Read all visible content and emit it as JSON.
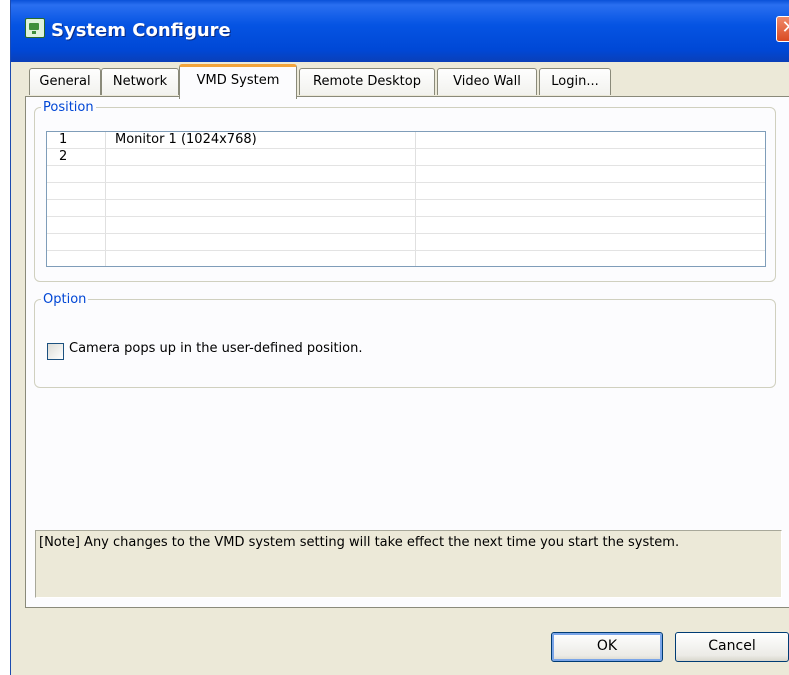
{
  "window": {
    "title": "System Configure",
    "close_glyph": "✕"
  },
  "tabs": [
    {
      "label": "General",
      "active": false
    },
    {
      "label": "Network",
      "active": false
    },
    {
      "label": "VMD System",
      "active": true
    },
    {
      "label": "Remote Desktop",
      "active": false
    },
    {
      "label": "Video Wall",
      "active": false
    },
    {
      "label": "Login...",
      "active": false
    }
  ],
  "position": {
    "legend": "Position",
    "rows": [
      {
        "index": "1",
        "monitor": "Monitor 1  (1024x768)",
        "extra": ""
      },
      {
        "index": "2",
        "monitor": "",
        "extra": ""
      },
      {
        "index": "",
        "monitor": "",
        "extra": ""
      },
      {
        "index": "",
        "monitor": "",
        "extra": ""
      },
      {
        "index": "",
        "monitor": "",
        "extra": ""
      },
      {
        "index": "",
        "monitor": "",
        "extra": ""
      },
      {
        "index": "",
        "monitor": "",
        "extra": ""
      },
      {
        "index": "",
        "monitor": "",
        "extra": ""
      }
    ]
  },
  "option": {
    "legend": "Option",
    "checkbox_label": "Camera pops up in the user-defined position.",
    "checked": false
  },
  "note": "[Note] Any changes to the VMD system setting will take effect the next time you start the system.",
  "buttons": {
    "ok": "OK",
    "cancel": "Cancel"
  },
  "colors": {
    "title_bar": "#0554e3",
    "legend_text": "#0046d5",
    "dialog_bg": "#ece9d8",
    "active_tab_accent": "#f2a43c"
  },
  "icons": {
    "app": "monitor-app-icon",
    "close": "close-icon"
  }
}
